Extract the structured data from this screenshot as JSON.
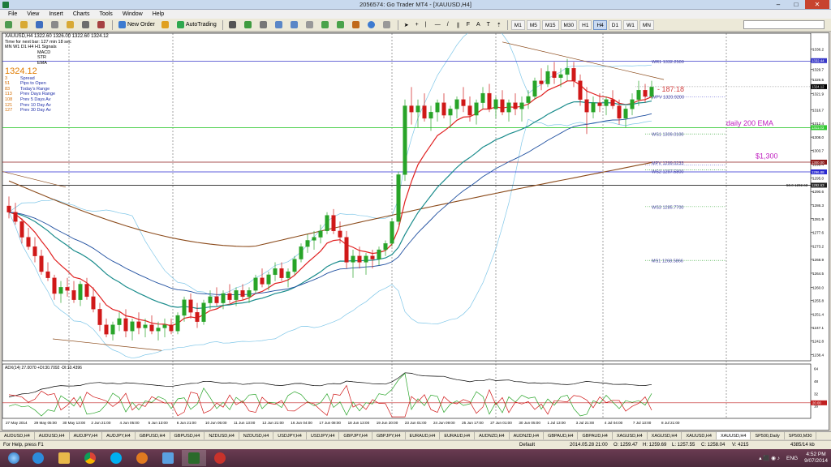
{
  "window": {
    "title": "2056574: Go Trader MT4 - [XAUUSD,H4]"
  },
  "menu": [
    "File",
    "View",
    "Insert",
    "Charts",
    "Tools",
    "Window",
    "Help"
  ],
  "toolbar": {
    "new_order": "New Order",
    "autotrading": "AutoTrading",
    "timeframes": [
      "M1",
      "M5",
      "M15",
      "M30",
      "H1",
      "H4",
      "D1",
      "W1",
      "MN"
    ],
    "active_timeframe": "H4"
  },
  "chart_info": {
    "symbol_line": "XAUUSD,H4  1322.60 1326.00 1322.60 1324.12",
    "timer_line": "Time for next bar: 127 min 18 sec",
    "tf_row": "MN  W1  D1  H4  H1  Signals",
    "indicator_labels": [
      "MACD",
      "STR",
      "EMA"
    ],
    "price": "1324.12",
    "stats": [
      {
        "n": "3",
        "label": "Spread"
      },
      {
        "n": "51",
        "label": "Pips to Open"
      },
      {
        "n": "83",
        "label": "Today's Range"
      },
      {
        "n": "113",
        "label": "Prev Days Range"
      },
      {
        "n": "108",
        "label": "Prev 5 Days Av"
      },
      {
        "n": "121",
        "label": "Prev 10 Day Av"
      },
      {
        "n": "127",
        "label": "Prev 30 Day Av"
      }
    ]
  },
  "chart_data": {
    "type": "candlestick",
    "symbol": "XAUUSD",
    "timeframe": "H4",
    "ylim": [
      1236.5,
      1341.2
    ],
    "y_ticks": [
      1336.2,
      1332.44,
      1329.7,
      1326.45,
      1321.9,
      1316.7,
      1312.4,
      1308.0,
      1303.7,
      1299.4,
      1295.0,
      1290.6,
      1286.3,
      1281.9,
      1277.6,
      1273.2,
      1268.9,
      1264.5,
      1260.0,
      1255.8,
      1251.4,
      1247.1,
      1242.8,
      1238.4
    ],
    "price_marker": "1324.12",
    "x_labels": [
      "27 May 2014",
      "29 May 05:00",
      "30 May 13:00",
      "2 Jun 21:00",
      "4 Jun 05:00",
      "5 Jun 13:00",
      "6 Jun 21:00",
      "10 Jun 05:00",
      "11 Jun 13:00",
      "12 Jun 21:00",
      "16 Jun 04:00",
      "17 Jun 08:00",
      "18 Jun 13:00",
      "19 Jun 20:00",
      "23 Jun 01:00",
      "24 Jun 09:00",
      "25 Jun 17:00",
      "27 Jun 01:00",
      "30 Jun 05:00",
      "1 Jul 13:00",
      "3 Jul 21:00",
      "4 Jul 04:00",
      "7 Jul 13:00",
      "8 Jul 21:00"
    ],
    "levels": [
      {
        "name": "WR1",
        "label": "WR1   1332.2500",
        "value": 1332.25,
        "color": "#3838c8",
        "style": "solid"
      },
      {
        "name": "WPV",
        "label": "WPV   1320.9200",
        "value": 1320.92,
        "color": "#3838c8",
        "style": "dotted"
      },
      {
        "name": "WS1",
        "label": "WS1   1309.0100",
        "value": 1309.01,
        "color": "#1a9a1a",
        "style": "dotted"
      },
      {
        "name": "MPV",
        "label": "MPV   1299.0233",
        "value": 1299.02,
        "color": "#3838c8",
        "style": "dotted"
      },
      {
        "name": "WS2",
        "label": "WS2   1297.5800",
        "value": 1297.58,
        "color": "#1a9a1a",
        "style": "dotted"
      },
      {
        "name": "WS3",
        "label": "WS3   1285.7700",
        "value": 1285.77,
        "color": "#1a9a1a",
        "style": "dotted"
      },
      {
        "name": "MS1",
        "label": "MS1   1268.5866",
        "value": 1268.59,
        "color": "#1a9a1a",
        "style": "dotted"
      }
    ],
    "hlines": [
      {
        "name": "line-1300",
        "value": 1300.0,
        "color": "#8b1a1a",
        "tag": "1300.00"
      },
      {
        "name": "line-1296",
        "value": 1296.88,
        "color": "#2a2ad0",
        "tag": "1296.88"
      },
      {
        "name": "line-1311",
        "value": 1311.03,
        "color": "#32c832",
        "tag": "1311.03"
      },
      {
        "name": "line-1293",
        "value": 1292.63,
        "color": "#202020",
        "tag": "1292.63"
      }
    ],
    "fib_label": "50.0  1292.63",
    "annotations": {
      "countdown": "187:18",
      "ema200": "daily 200 EMA",
      "level1300": "$1,300"
    },
    "candles": [
      [
        1,
        1286,
        1289,
        1282,
        1284
      ],
      [
        2,
        1284,
        1287,
        1280,
        1281
      ],
      [
        3,
        1281,
        1282,
        1274,
        1276
      ],
      [
        4,
        1276,
        1279,
        1272,
        1273
      ],
      [
        5,
        1273,
        1276,
        1268,
        1270
      ],
      [
        6,
        1270,
        1272,
        1264,
        1265
      ],
      [
        7,
        1265,
        1268,
        1262,
        1263
      ],
      [
        8,
        1263,
        1264,
        1256,
        1258
      ],
      [
        9,
        1258,
        1262,
        1255,
        1260
      ],
      [
        10,
        1260,
        1263,
        1257,
        1259
      ],
      [
        11,
        1259,
        1262,
        1255,
        1256
      ],
      [
        12,
        1256,
        1262,
        1254,
        1261
      ],
      [
        13,
        1261,
        1263,
        1256,
        1257
      ],
      [
        14,
        1257,
        1260,
        1252,
        1253
      ],
      [
        15,
        1253,
        1255,
        1246,
        1248
      ],
      [
        16,
        1248,
        1250,
        1244,
        1245
      ],
      [
        17,
        1245,
        1249,
        1243,
        1248
      ],
      [
        18,
        1248,
        1252,
        1246,
        1250
      ],
      [
        19,
        1250,
        1253,
        1244,
        1246
      ],
      [
        20,
        1246,
        1250,
        1243,
        1249
      ],
      [
        21,
        1249,
        1252,
        1245,
        1247
      ],
      [
        22,
        1247,
        1250,
        1244,
        1248
      ],
      [
        23,
        1248,
        1251,
        1245,
        1246
      ],
      [
        24,
        1246,
        1249,
        1243,
        1247
      ],
      [
        25,
        1247,
        1250,
        1244,
        1248
      ],
      [
        26,
        1248,
        1250,
        1245,
        1246
      ],
      [
        27,
        1246,
        1252,
        1245,
        1251
      ],
      [
        28,
        1251,
        1257,
        1249,
        1256
      ],
      [
        29,
        1256,
        1258,
        1250,
        1252
      ],
      [
        30,
        1252,
        1255,
        1247,
        1249
      ],
      [
        31,
        1249,
        1256,
        1248,
        1255
      ],
      [
        32,
        1255,
        1259,
        1253,
        1257
      ],
      [
        33,
        1257,
        1260,
        1254,
        1255
      ],
      [
        34,
        1255,
        1259,
        1253,
        1258
      ],
      [
        35,
        1258,
        1261,
        1255,
        1256
      ],
      [
        36,
        1256,
        1260,
        1254,
        1259
      ],
      [
        37,
        1259,
        1261,
        1256,
        1257
      ],
      [
        38,
        1257,
        1260,
        1255,
        1259
      ],
      [
        39,
        1259,
        1264,
        1258,
        1263
      ],
      [
        40,
        1263,
        1266,
        1260,
        1261
      ],
      [
        41,
        1261,
        1265,
        1259,
        1264
      ],
      [
        42,
        1264,
        1268,
        1262,
        1266
      ],
      [
        43,
        1266,
        1268,
        1262,
        1263
      ],
      [
        44,
        1263,
        1266,
        1260,
        1265
      ],
      [
        45,
        1265,
        1270,
        1264,
        1269
      ],
      [
        46,
        1269,
        1274,
        1268,
        1273
      ],
      [
        47,
        1273,
        1277,
        1271,
        1275
      ],
      [
        48,
        1275,
        1278,
        1272,
        1276
      ],
      [
        49,
        1276,
        1280,
        1274,
        1278
      ],
      [
        50,
        1278,
        1284,
        1277,
        1283
      ],
      [
        51,
        1283,
        1285,
        1277,
        1278
      ],
      [
        52,
        1278,
        1281,
        1274,
        1276
      ],
      [
        53,
        1276,
        1278,
        1266,
        1268
      ],
      [
        54,
        1268,
        1272,
        1263,
        1270
      ],
      [
        55,
        1270,
        1273,
        1266,
        1268
      ],
      [
        56,
        1268,
        1271,
        1264,
        1270
      ],
      [
        57,
        1270,
        1272,
        1266,
        1269
      ],
      [
        58,
        1269,
        1273,
        1267,
        1272
      ],
      [
        59,
        1272,
        1275,
        1270,
        1274
      ],
      [
        60,
        1274,
        1282,
        1273,
        1281
      ],
      [
        61,
        1281,
        1297,
        1280,
        1296
      ],
      [
        62,
        1296,
        1320,
        1294,
        1318
      ],
      [
        63,
        1318,
        1324,
        1312,
        1316
      ],
      [
        64,
        1316,
        1320,
        1311,
        1318
      ],
      [
        65,
        1318,
        1322,
        1313,
        1314
      ],
      [
        66,
        1314,
        1318,
        1310,
        1316
      ],
      [
        67,
        1316,
        1320,
        1313,
        1319
      ],
      [
        68,
        1319,
        1322,
        1314,
        1315
      ],
      [
        69,
        1315,
        1318,
        1311,
        1317
      ],
      [
        70,
        1317,
        1321,
        1314,
        1320
      ],
      [
        71,
        1320,
        1324,
        1316,
        1318
      ],
      [
        72,
        1318,
        1321,
        1313,
        1315
      ],
      [
        73,
        1315,
        1320,
        1312,
        1319
      ],
      [
        74,
        1319,
        1324,
        1317,
        1322
      ],
      [
        75,
        1322,
        1325,
        1316,
        1317
      ],
      [
        76,
        1317,
        1321,
        1314,
        1320
      ],
      [
        77,
        1320,
        1323,
        1315,
        1316
      ],
      [
        78,
        1316,
        1320,
        1313,
        1319
      ],
      [
        79,
        1319,
        1322,
        1315,
        1317
      ],
      [
        80,
        1317,
        1321,
        1313,
        1319
      ],
      [
        81,
        1319,
        1323,
        1317,
        1321
      ],
      [
        82,
        1321,
        1327,
        1320,
        1326
      ],
      [
        83,
        1326,
        1330,
        1323,
        1325
      ],
      [
        84,
        1325,
        1331,
        1324,
        1329
      ],
      [
        85,
        1329,
        1332,
        1325,
        1327
      ],
      [
        86,
        1327,
        1330,
        1324,
        1328
      ],
      [
        87,
        1328,
        1333,
        1326,
        1330
      ],
      [
        88,
        1330,
        1332,
        1324,
        1326
      ],
      [
        89,
        1326,
        1328,
        1318,
        1320
      ],
      [
        90,
        1320,
        1324,
        1309,
        1316
      ],
      [
        91,
        1316,
        1321,
        1314,
        1319
      ],
      [
        92,
        1319,
        1322,
        1316,
        1318
      ],
      [
        93,
        1318,
        1321,
        1315,
        1320
      ],
      [
        94,
        1320,
        1323,
        1317,
        1318
      ],
      [
        95,
        1318,
        1320,
        1312,
        1314
      ],
      [
        96,
        1314,
        1318,
        1311,
        1317
      ],
      [
        97,
        1317,
        1322,
        1315,
        1320
      ],
      [
        98,
        1320,
        1326,
        1318,
        1323
      ],
      [
        99,
        1323,
        1325,
        1319,
        1321
      ],
      [
        100,
        1321,
        1326,
        1320,
        1324
      ]
    ],
    "adx_label": "ADX(14) 27.0070  +DI:30.7092  -DI:10.4396",
    "adx_ticks": [
      "64",
      "48",
      "32",
      "20",
      "16"
    ],
    "adx_level": "20.00"
  },
  "tabs": [
    "AUDUSD,H4",
    "AUDUSD,H4",
    "AUDJPY,H4",
    "AUDJPY,H4",
    "GBPUSD,H4",
    "GBPUSD,H4",
    "NZDUSD,H4",
    "NZDUSD,H4",
    "USDJPY,H4",
    "USDJPY,H4",
    "GBPJPY,H4",
    "GBPJPY,H4",
    "EURAUD,H4",
    "EURAUD,H4",
    "AUDNZD,H4",
    "AUDNZD,H4",
    "GBPAUD,H4",
    "GBPAUD,H4",
    "XAGUSD,H4",
    "XAGUSD,H4",
    "XAUUSD,H4",
    "XAUUSD,H4",
    "SP500,Daily",
    "SP500,M30"
  ],
  "active_tab": 21,
  "status": {
    "help": "For Help, press F1",
    "profile": "Default",
    "datetime": "2014.05.28 21:00",
    "open": "O: 1259.47",
    "high": "H: 1259.69",
    "low": "L: 1257.55",
    "close": "C: 1258.04",
    "volume": "V: 4215",
    "traffic": "4385/14 kb"
  },
  "taskbar": {
    "lang": "ENG",
    "time": "4:52 PM",
    "date": "9/07/2014"
  }
}
